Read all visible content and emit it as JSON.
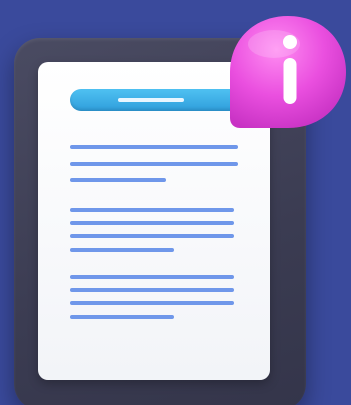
{
  "illustration": {
    "subject": "document-with-info-badge",
    "icons": [
      "clipboard-icon",
      "document-icon",
      "info-icon"
    ]
  },
  "colors": {
    "background": "#3a4a9c",
    "clipboard": "#3f4057",
    "paper": "#f7f8fb",
    "header_bar": "#3aaee6",
    "text_lines": "#6f97ea",
    "badge": "#e84ee0"
  }
}
